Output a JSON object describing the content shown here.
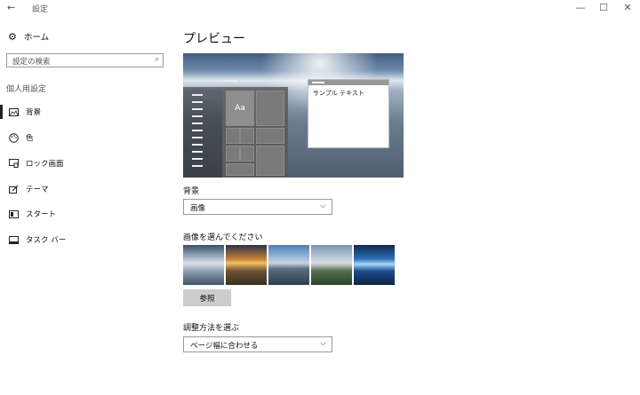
{
  "window": {
    "title": "設定",
    "back_icon": "←",
    "minimize": "—",
    "maximize": "☐",
    "close": "✕"
  },
  "sidebar": {
    "home_label": "ホーム",
    "search_placeholder": "設定の検索",
    "section_title": "個人用設定",
    "items": [
      {
        "label": "背景",
        "icon": "picture-icon"
      },
      {
        "label": "色",
        "icon": "palette-icon"
      },
      {
        "label": "ロック画面",
        "icon": "lock-screen-icon"
      },
      {
        "label": "テーマ",
        "icon": "theme-icon"
      },
      {
        "label": "スタート",
        "icon": "start-icon"
      },
      {
        "label": "タスク バー",
        "icon": "taskbar-icon"
      }
    ],
    "active_index": 0
  },
  "main": {
    "preview_heading": "プレビュー",
    "preview_tile_label": "Aa",
    "preview_window_text": "サンプル テキスト",
    "background_label": "背景",
    "background_value": "画像",
    "choose_picture_label": "画像を選んでください",
    "browse_label": "参照",
    "fit_label": "調整方法を選ぶ",
    "fit_value": "ページ幅に合わせる"
  }
}
